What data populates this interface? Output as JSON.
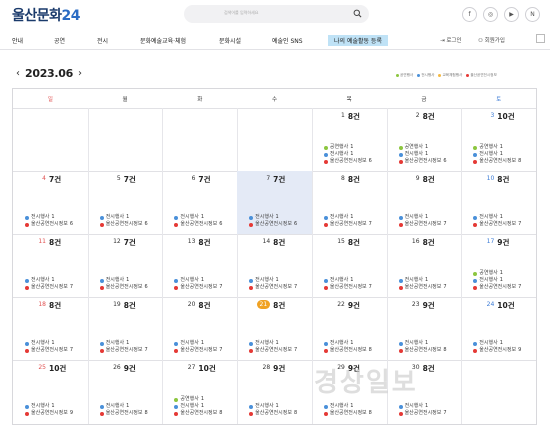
{
  "site": {
    "logo_main": "울산문화",
    "logo_num": "24",
    "search_placeholder": "검색어를 입력하세요"
  },
  "social": [
    {
      "label": "f",
      "icon": "facebook-icon"
    },
    {
      "label": "◎",
      "icon": "instagram-icon"
    },
    {
      "label": "▶",
      "icon": "youtube-icon"
    },
    {
      "label": "N",
      "icon": "naver-blog-icon"
    }
  ],
  "nav": {
    "items": [
      "안내",
      "공연",
      "전시",
      "문화예술교육·체험",
      "문화시설",
      "예술인 SNS",
      "나의 예술활동 등록"
    ],
    "active_index": 6,
    "login": "로그인",
    "join": "회원가입"
  },
  "calendar": {
    "month": "2023.06",
    "prev": "‹",
    "next": "›",
    "weekdays": [
      "일",
      "월",
      "화",
      "수",
      "목",
      "금",
      "토"
    ],
    "legend": [
      {
        "label": "공연행사",
        "color": "#8cc63f"
      },
      {
        "label": "전시행사",
        "color": "#4a90d9"
      },
      {
        "label": "교육체험행사",
        "color": "#f5b942"
      },
      {
        "label": "울산공연전시정보",
        "color": "#e53935"
      }
    ],
    "event_colors": {
      "공연": "#8cc63f",
      "전시": "#4a90d9",
      "정보": "#e53935"
    },
    "weeks": [
      [
        null,
        null,
        null,
        null,
        {
          "day": "1",
          "count": "8건",
          "events": [
            {
              "type": "공연",
              "label": "공연행사",
              "n": "1"
            },
            {
              "type": "전시",
              "label": "전시행사",
              "n": "1"
            },
            {
              "type": "정보",
              "label": "울산공연전시정보",
              "n": "6"
            }
          ]
        },
        {
          "day": "2",
          "count": "8건",
          "events": [
            {
              "type": "공연",
              "label": "공연행사",
              "n": "1"
            },
            {
              "type": "전시",
              "label": "전시행사",
              "n": "1"
            },
            {
              "type": "정보",
              "label": "울산공연전시정보",
              "n": "6"
            }
          ]
        },
        {
          "day": "3",
          "count": "10건",
          "events": [
            {
              "type": "공연",
              "label": "공연행사",
              "n": "1"
            },
            {
              "type": "전시",
              "label": "전시행사",
              "n": "1"
            },
            {
              "type": "정보",
              "label": "울산공연전시정보",
              "n": "8"
            }
          ]
        }
      ],
      [
        {
          "day": "4",
          "count": "7건",
          "events": [
            {
              "type": "전시",
              "label": "전시행사",
              "n": "1"
            },
            {
              "type": "정보",
              "label": "울산공연전시정보",
              "n": "6"
            }
          ]
        },
        {
          "day": "5",
          "count": "7건",
          "events": [
            {
              "type": "전시",
              "label": "전시행사",
              "n": "1"
            },
            {
              "type": "정보",
              "label": "울산공연전시정보",
              "n": "6"
            }
          ]
        },
        {
          "day": "6",
          "count": "7건",
          "events": [
            {
              "type": "전시",
              "label": "전시행사",
              "n": "1"
            },
            {
              "type": "정보",
              "label": "울산공연전시정보",
              "n": "6"
            }
          ]
        },
        {
          "day": "7",
          "count": "7건",
          "highlight": true,
          "events": [
            {
              "type": "전시",
              "label": "전시행사",
              "n": "1"
            },
            {
              "type": "정보",
              "label": "울산공연전시정보",
              "n": "6"
            }
          ]
        },
        {
          "day": "8",
          "count": "8건",
          "events": [
            {
              "type": "전시",
              "label": "전시행사",
              "n": "1"
            },
            {
              "type": "정보",
              "label": "울산공연전시정보",
              "n": "7"
            }
          ]
        },
        {
          "day": "9",
          "count": "8건",
          "events": [
            {
              "type": "전시",
              "label": "전시행사",
              "n": "1"
            },
            {
              "type": "정보",
              "label": "울산공연전시정보",
              "n": "7"
            }
          ]
        },
        {
          "day": "10",
          "count": "8건",
          "events": [
            {
              "type": "전시",
              "label": "전시행사",
              "n": "1"
            },
            {
              "type": "정보",
              "label": "울산공연전시정보",
              "n": "7"
            }
          ]
        }
      ],
      [
        {
          "day": "11",
          "count": "8건",
          "events": [
            {
              "type": "전시",
              "label": "전시행사",
              "n": "1"
            },
            {
              "type": "정보",
              "label": "울산공연전시정보",
              "n": "7"
            }
          ]
        },
        {
          "day": "12",
          "count": "7건",
          "events": [
            {
              "type": "전시",
              "label": "전시행사",
              "n": "1"
            },
            {
              "type": "정보",
              "label": "울산공연전시정보",
              "n": "6"
            }
          ]
        },
        {
          "day": "13",
          "count": "8건",
          "events": [
            {
              "type": "전시",
              "label": "전시행사",
              "n": "1"
            },
            {
              "type": "정보",
              "label": "울산공연전시정보",
              "n": "7"
            }
          ]
        },
        {
          "day": "14",
          "count": "8건",
          "events": [
            {
              "type": "전시",
              "label": "전시행사",
              "n": "1"
            },
            {
              "type": "정보",
              "label": "울산공연전시정보",
              "n": "7"
            }
          ]
        },
        {
          "day": "15",
          "count": "8건",
          "events": [
            {
              "type": "전시",
              "label": "전시행사",
              "n": "1"
            },
            {
              "type": "정보",
              "label": "울산공연전시정보",
              "n": "7"
            }
          ]
        },
        {
          "day": "16",
          "count": "8건",
          "events": [
            {
              "type": "전시",
              "label": "전시행사",
              "n": "1"
            },
            {
              "type": "정보",
              "label": "울산공연전시정보",
              "n": "7"
            }
          ]
        },
        {
          "day": "17",
          "count": "9건",
          "events": [
            {
              "type": "공연",
              "label": "공연행사",
              "n": "1"
            },
            {
              "type": "전시",
              "label": "전시행사",
              "n": "1"
            },
            {
              "type": "정보",
              "label": "울산공연전시정보",
              "n": "7"
            }
          ]
        }
      ],
      [
        {
          "day": "18",
          "count": "8건",
          "events": [
            {
              "type": "전시",
              "label": "전시행사",
              "n": "1"
            },
            {
              "type": "정보",
              "label": "울산공연전시정보",
              "n": "7"
            }
          ]
        },
        {
          "day": "19",
          "count": "8건",
          "events": [
            {
              "type": "전시",
              "label": "전시행사",
              "n": "1"
            },
            {
              "type": "정보",
              "label": "울산공연전시정보",
              "n": "7"
            }
          ]
        },
        {
          "day": "20",
          "count": "8건",
          "events": [
            {
              "type": "전시",
              "label": "전시행사",
              "n": "1"
            },
            {
              "type": "정보",
              "label": "울산공연전시정보",
              "n": "7"
            }
          ]
        },
        {
          "day": "21",
          "count": "8건",
          "today": true,
          "events": [
            {
              "type": "전시",
              "label": "전시행사",
              "n": "1"
            },
            {
              "type": "정보",
              "label": "울산공연전시정보",
              "n": "7"
            }
          ]
        },
        {
          "day": "22",
          "count": "9건",
          "events": [
            {
              "type": "전시",
              "label": "전시행사",
              "n": "1"
            },
            {
              "type": "정보",
              "label": "울산공연전시정보",
              "n": "8"
            }
          ]
        },
        {
          "day": "23",
          "count": "9건",
          "events": [
            {
              "type": "전시",
              "label": "전시행사",
              "n": "1"
            },
            {
              "type": "정보",
              "label": "울산공연전시정보",
              "n": "8"
            }
          ]
        },
        {
          "day": "24",
          "count": "10건",
          "events": [
            {
              "type": "전시",
              "label": "전시행사",
              "n": "1"
            },
            {
              "type": "정보",
              "label": "울산공연전시정보",
              "n": "9"
            }
          ]
        }
      ],
      [
        {
          "day": "25",
          "count": "10건",
          "events": [
            {
              "type": "전시",
              "label": "전시행사",
              "n": "1"
            },
            {
              "type": "정보",
              "label": "울산공연전시정보",
              "n": "9"
            }
          ]
        },
        {
          "day": "26",
          "count": "9건",
          "events": [
            {
              "type": "전시",
              "label": "전시행사",
              "n": "1"
            },
            {
              "type": "정보",
              "label": "울산공연전시정보",
              "n": "8"
            }
          ]
        },
        {
          "day": "27",
          "count": "10건",
          "events": [
            {
              "type": "공연",
              "label": "공연행사",
              "n": "1"
            },
            {
              "type": "전시",
              "label": "전시행사",
              "n": "1"
            },
            {
              "type": "정보",
              "label": "울산공연전시정보",
              "n": "8"
            }
          ]
        },
        {
          "day": "28",
          "count": "9건",
          "events": [
            {
              "type": "전시",
              "label": "전시행사",
              "n": "1"
            },
            {
              "type": "정보",
              "label": "울산공연전시정보",
              "n": "8"
            }
          ]
        },
        {
          "day": "29",
          "count": "9건",
          "events": [
            {
              "type": "전시",
              "label": "전시행사",
              "n": "1"
            },
            {
              "type": "정보",
              "label": "울산공연전시정보",
              "n": "8"
            }
          ]
        },
        {
          "day": "30",
          "count": "8건",
          "events": [
            {
              "type": "전시",
              "label": "전시행사",
              "n": "1"
            },
            {
              "type": "정보",
              "label": "울산공연전시정보",
              "n": "7"
            }
          ]
        },
        null
      ]
    ]
  },
  "watermark": "경상일보"
}
